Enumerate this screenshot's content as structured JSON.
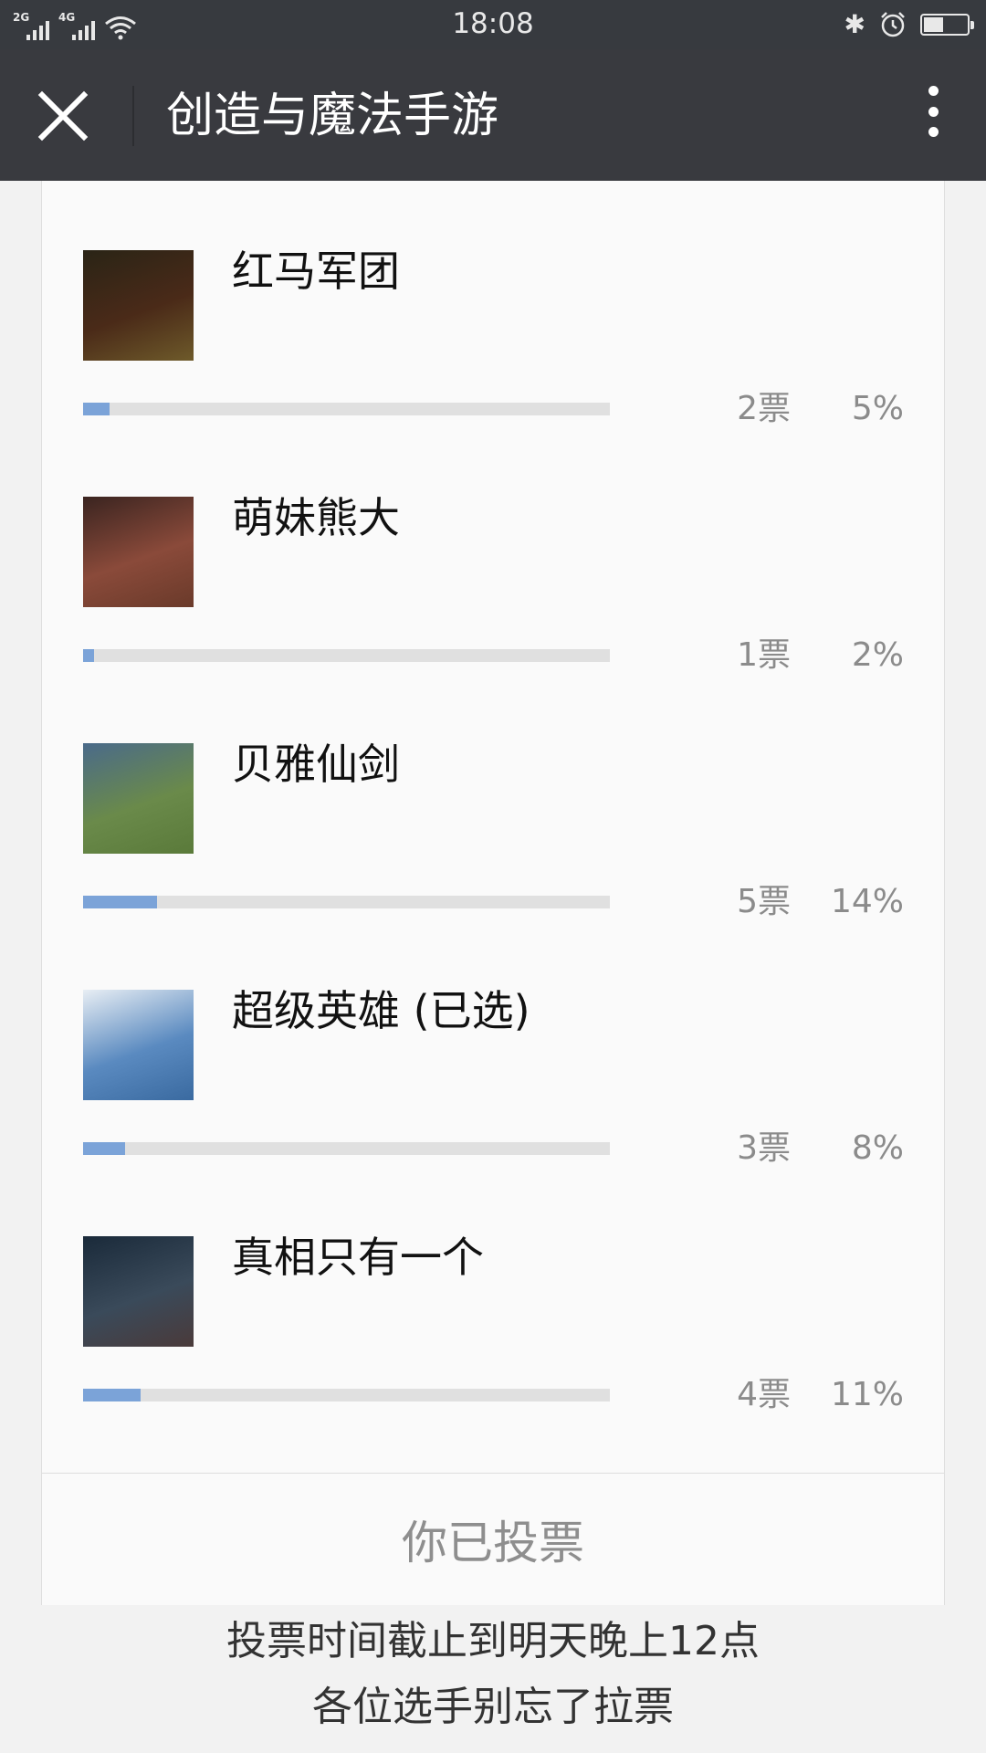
{
  "status_bar": {
    "network_1": "2G",
    "network_2": "4G",
    "time": "18:08",
    "bluetooth_icon": "bluetooth-icon",
    "alarm_icon": "alarm-icon",
    "battery_level": 0.45
  },
  "title_bar": {
    "title": "创造与魔法手游",
    "close_icon": "close-icon",
    "more_icon": "more-vertical-icon"
  },
  "poll": {
    "options": [
      {
        "label": "红马军团",
        "votes": "2票",
        "percent": "5%",
        "fraction": 0.05,
        "thumb_colors": [
          "#2a2416",
          "#4a2a18",
          "#6e5a2a"
        ]
      },
      {
        "label": "萌妹熊大",
        "votes": "1票",
        "percent": "2%",
        "fraction": 0.02,
        "thumb_colors": [
          "#3a2420",
          "#8a4a3a",
          "#6a3a2a"
        ]
      },
      {
        "label": "贝雅仙剑",
        "votes": "5票",
        "percent": "14%",
        "fraction": 0.14,
        "thumb_colors": [
          "#4a6a8a",
          "#6a8a4a",
          "#5a7a3a"
        ]
      },
      {
        "label": "超级英雄 (已选)",
        "votes": "3票",
        "percent": "8%",
        "fraction": 0.08,
        "thumb_colors": [
          "#e8eef4",
          "#5a8ac0",
          "#3a6aa0"
        ]
      },
      {
        "label": "真相只有一个",
        "votes": "4票",
        "percent": "11%",
        "fraction": 0.11,
        "thumb_colors": [
          "#1a2a3a",
          "#3a4a5a",
          "#4a3a3a"
        ]
      }
    ],
    "voted_label": "你已投票"
  },
  "footer": {
    "line1": "投票时间截止到明天晚上12点",
    "line2": "各位选手别忘了拉票"
  }
}
